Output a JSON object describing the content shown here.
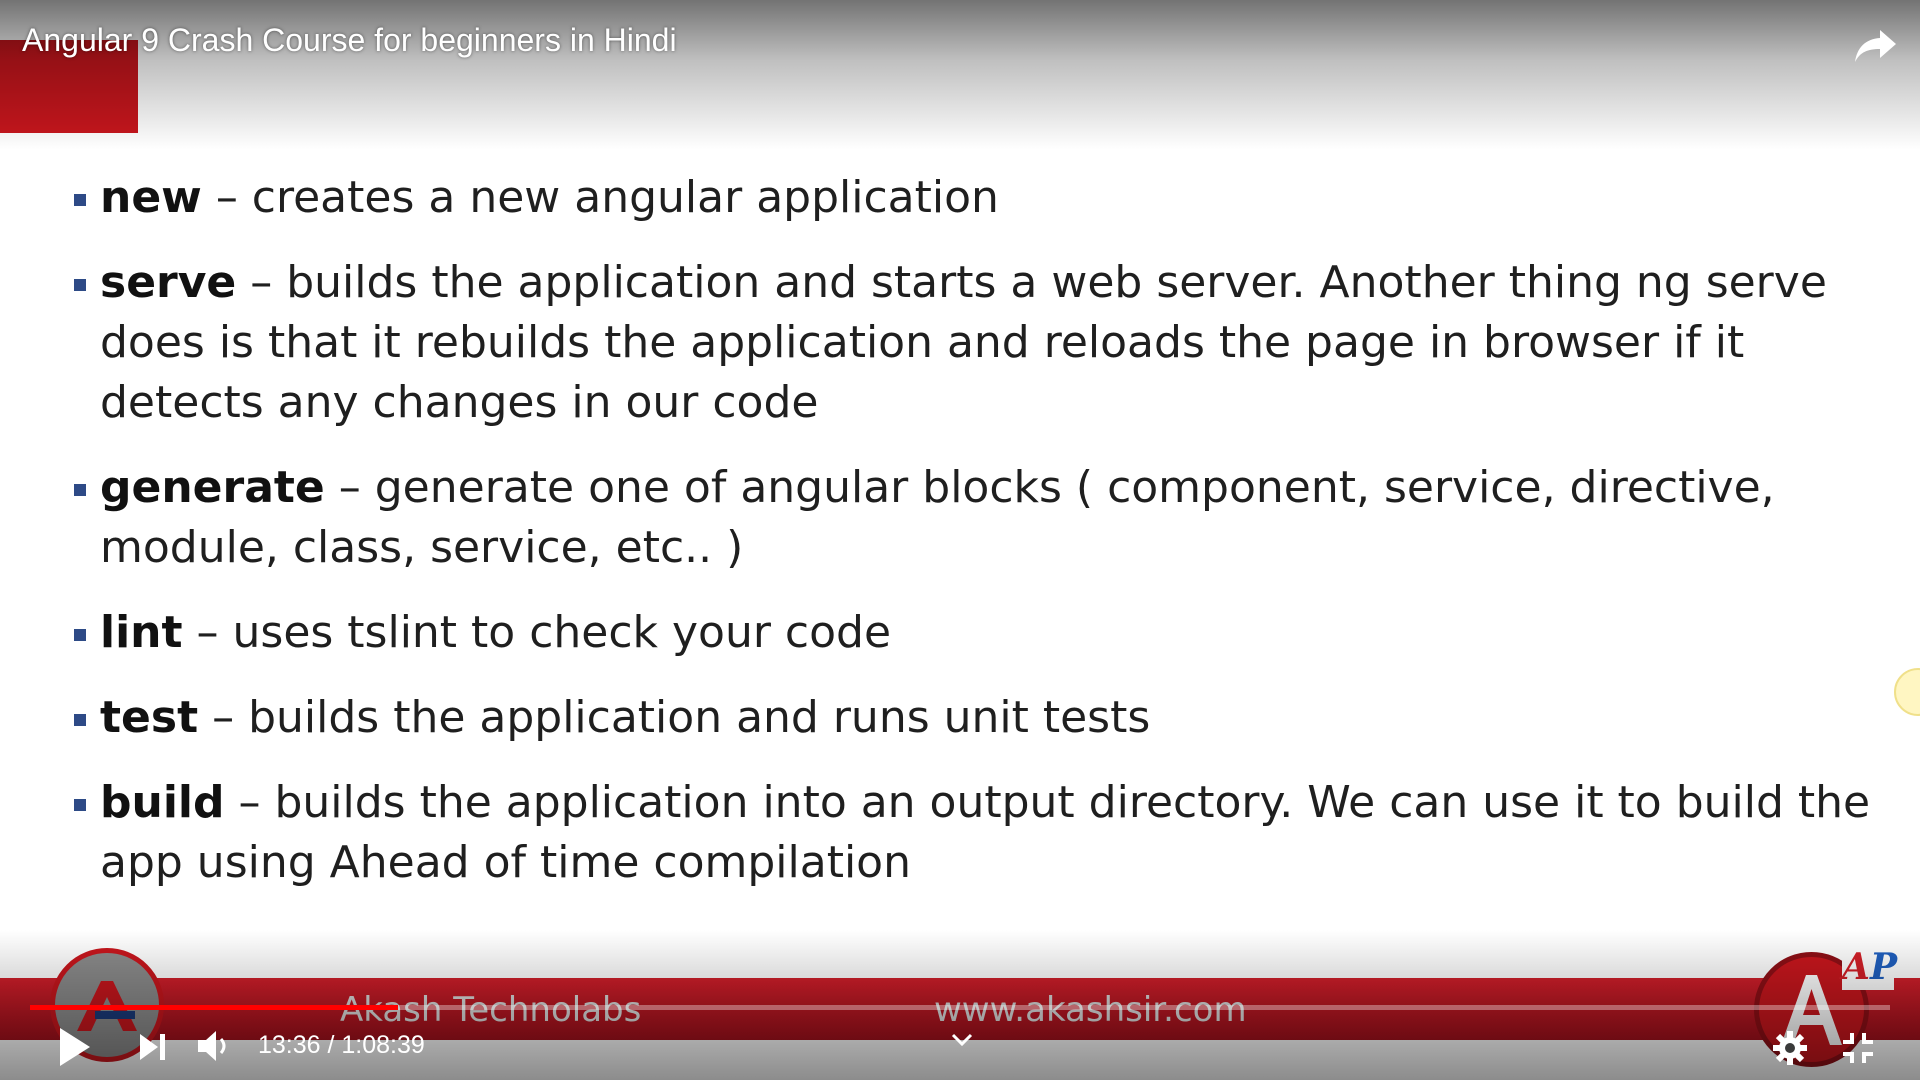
{
  "player": {
    "title": "Angular 9 Crash Course for beginners in Hindi",
    "time_display": "13:36 / 1:08:39",
    "progress": 0.198
  },
  "slide": {
    "bullets": [
      {
        "command": "new",
        "text": " – creates a new angular application"
      },
      {
        "command": "serve",
        "text": " – builds the application and starts a web server. Another thing ng serve does is that it rebuilds the application and reloads the page in browser if it detects any changes in our code"
      },
      {
        "command": "generate",
        "text": " – generate one of angular blocks ( component, service, directive, module, class, service, etc.. )"
      },
      {
        "command": "lint",
        "text": " – uses tslint to check your code"
      },
      {
        "command": "test",
        "text": " – builds the application and runs unit tests"
      },
      {
        "command": "build",
        "text": " – builds the application into an output directory. We can use it to build the app using Ahead of time compilation"
      }
    ],
    "footer_brand": "Akash Technolabs",
    "footer_url": "www.akashsir.com",
    "badge_a": "A",
    "badge_p": "P"
  },
  "colors": {
    "accent_red": "#c8161d",
    "progress_red": "#ff0000",
    "bullet_blue": "#2d4a86"
  },
  "icons": [
    "share-icon",
    "play-icon",
    "next-icon",
    "volume-icon",
    "chevron-down-icon",
    "gear-icon",
    "exit-fullscreen-icon"
  ]
}
